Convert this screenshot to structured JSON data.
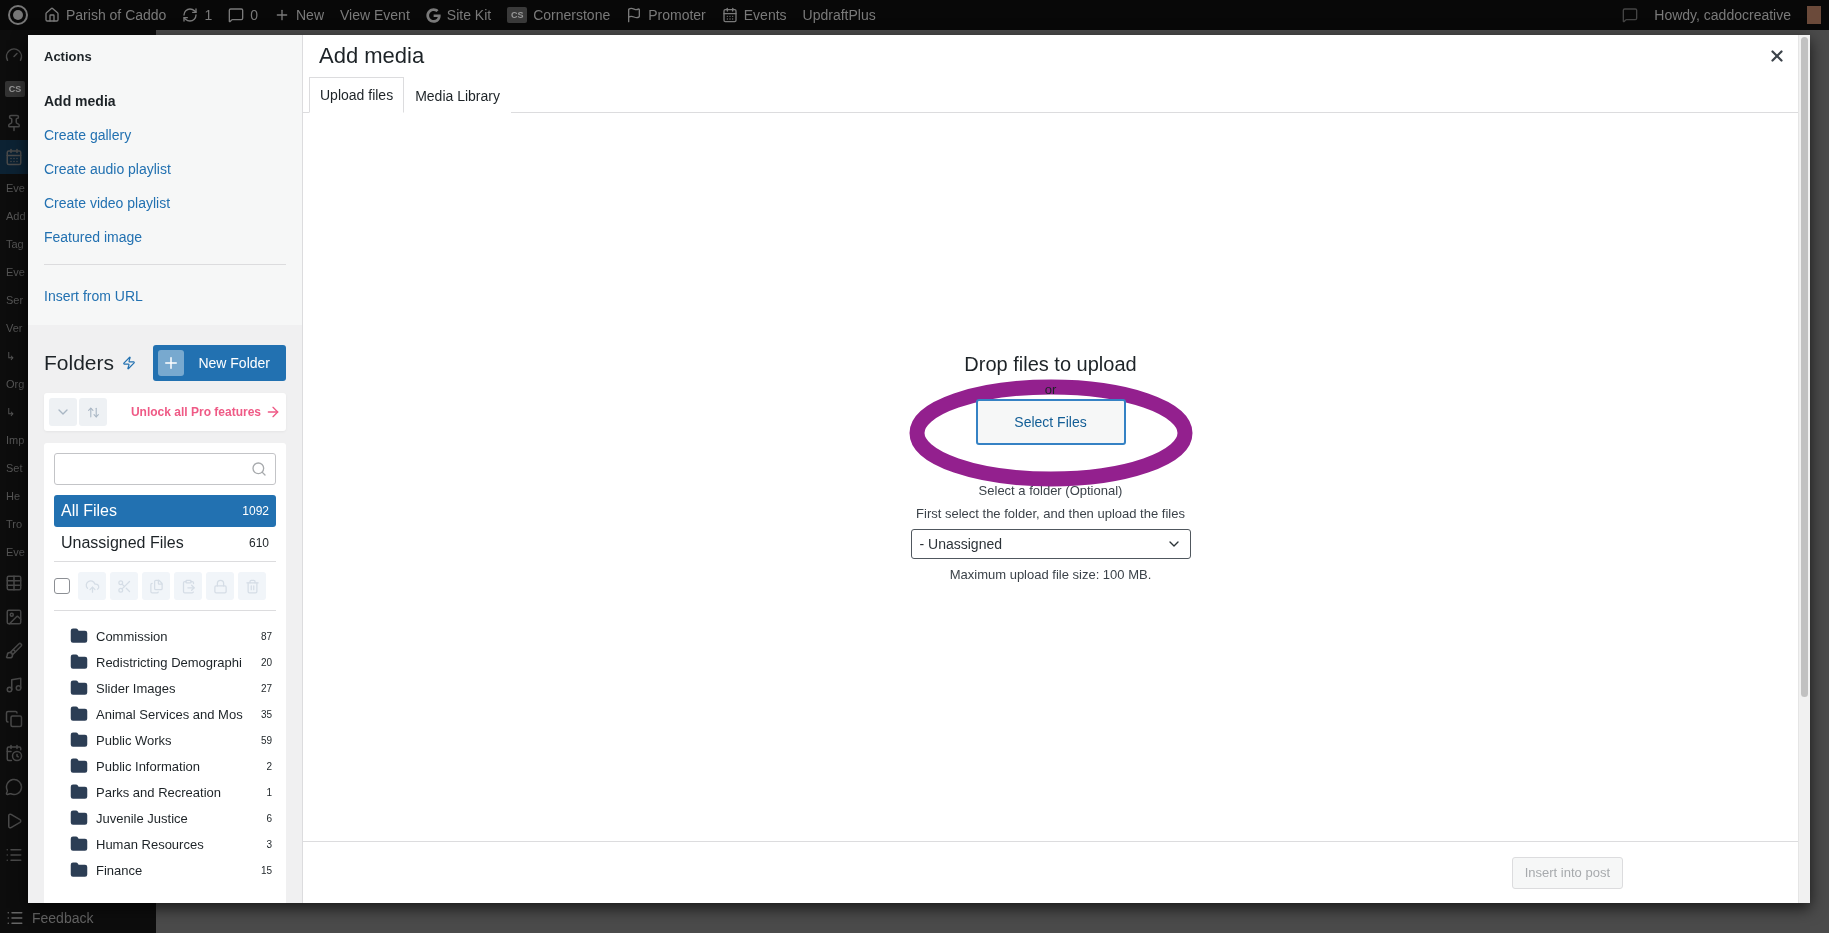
{
  "admin_bar": {
    "items": [
      {
        "kind": "wp-logo"
      },
      {
        "kind": "home",
        "label": "Parish of Caddo"
      },
      {
        "kind": "updates",
        "label": "1"
      },
      {
        "kind": "comments",
        "label": "0"
      },
      {
        "kind": "new",
        "label": "New"
      },
      {
        "kind": "text",
        "label": "View Event"
      },
      {
        "kind": "sitekit",
        "label": "Site Kit"
      },
      {
        "kind": "cornerstone",
        "badge": "CS",
        "label": "Cornerstone"
      },
      {
        "kind": "promoter",
        "label": "Promoter"
      },
      {
        "kind": "events",
        "label": "Events"
      },
      {
        "kind": "text",
        "label": "UpdraftPlus"
      }
    ],
    "greeting": "Howdy, caddocreative"
  },
  "admin_menu": {
    "items": [
      {
        "kind": "gauge",
        "selected": false
      },
      {
        "kind": "badge",
        "label": "CS",
        "selected": false
      },
      {
        "kind": "pin",
        "selected": false
      },
      {
        "kind": "calendar",
        "selected": true
      },
      {
        "kind": "text",
        "label": "Eve"
      },
      {
        "kind": "text",
        "label": "Add"
      },
      {
        "kind": "text",
        "label": "Tag"
      },
      {
        "kind": "text",
        "label": "Eve"
      },
      {
        "kind": "text",
        "label": "Ser"
      },
      {
        "kind": "text",
        "label": "Ver"
      },
      {
        "kind": "text",
        "label": "↳"
      },
      {
        "kind": "text",
        "label": "Org"
      },
      {
        "kind": "text",
        "label": "↳"
      },
      {
        "kind": "text",
        "label": "Imp"
      },
      {
        "kind": "text",
        "label": "Set"
      },
      {
        "kind": "text",
        "label": "He"
      },
      {
        "kind": "text",
        "label": "Tro"
      },
      {
        "kind": "text",
        "label": "Eve"
      },
      {
        "kind": "table",
        "selected": false
      },
      {
        "kind": "image",
        "selected": false
      },
      {
        "kind": "brush",
        "selected": false
      },
      {
        "kind": "music",
        "selected": false
      },
      {
        "kind": "pages",
        "selected": false
      },
      {
        "kind": "calendar-list",
        "selected": false
      },
      {
        "kind": "comment",
        "selected": false
      },
      {
        "kind": "play",
        "selected": false
      },
      {
        "kind": "list",
        "selected": false
      }
    ],
    "footer": "Feedback"
  },
  "modal": {
    "title": "Add media",
    "actions": {
      "heading": "Actions",
      "items": [
        {
          "label": "Add media",
          "selected": true
        },
        {
          "label": "Create gallery",
          "selected": false
        },
        {
          "label": "Create audio playlist",
          "selected": false
        },
        {
          "label": "Create video playlist",
          "selected": false
        },
        {
          "label": "Featured image",
          "selected": false
        }
      ],
      "insert_from_url": "Insert from URL"
    },
    "folders": {
      "title": "Folders",
      "new_button": "New Folder",
      "pro_link": "Unlock all Pro features",
      "filters": [
        {
          "label": "All Files",
          "count": "1092",
          "selected": true
        },
        {
          "label": "Unassigned Files",
          "count": "610",
          "selected": false
        }
      ],
      "select_all": {
        "checked": false
      },
      "tools": [
        {
          "kind": "upload"
        },
        {
          "kind": "cut"
        },
        {
          "kind": "copy"
        },
        {
          "kind": "paste"
        },
        {
          "kind": "lock"
        },
        {
          "kind": "delete"
        }
      ],
      "items": [
        {
          "name": "Commission",
          "count": "87"
        },
        {
          "name": "Redistricting Demographi",
          "count": "20"
        },
        {
          "name": "Slider Images",
          "count": "27"
        },
        {
          "name": "Animal Services and Mos",
          "count": "35"
        },
        {
          "name": "Public Works",
          "count": "59"
        },
        {
          "name": "Public Information",
          "count": "2"
        },
        {
          "name": "Parks and Recreation",
          "count": "1"
        },
        {
          "name": "Juvenile Justice",
          "count": "6"
        },
        {
          "name": "Human Resources",
          "count": "3"
        },
        {
          "name": "Finance",
          "count": "15"
        }
      ]
    },
    "tabs": [
      {
        "label": "Upload files",
        "selected": true
      },
      {
        "label": "Media Library",
        "selected": false
      }
    ],
    "upload": {
      "heading": "Drop files to upload",
      "or": "or",
      "button": "Select Files",
      "folder_label": "Select a folder (Optional)",
      "folder_hint": "First select the folder, and then upload the files",
      "folder_value": "- Unassigned",
      "max_size": "Maximum upload file size: 100 MB.",
      "highlighted": true
    },
    "footer": {
      "button": "Insert into post",
      "disabled": true
    }
  }
}
